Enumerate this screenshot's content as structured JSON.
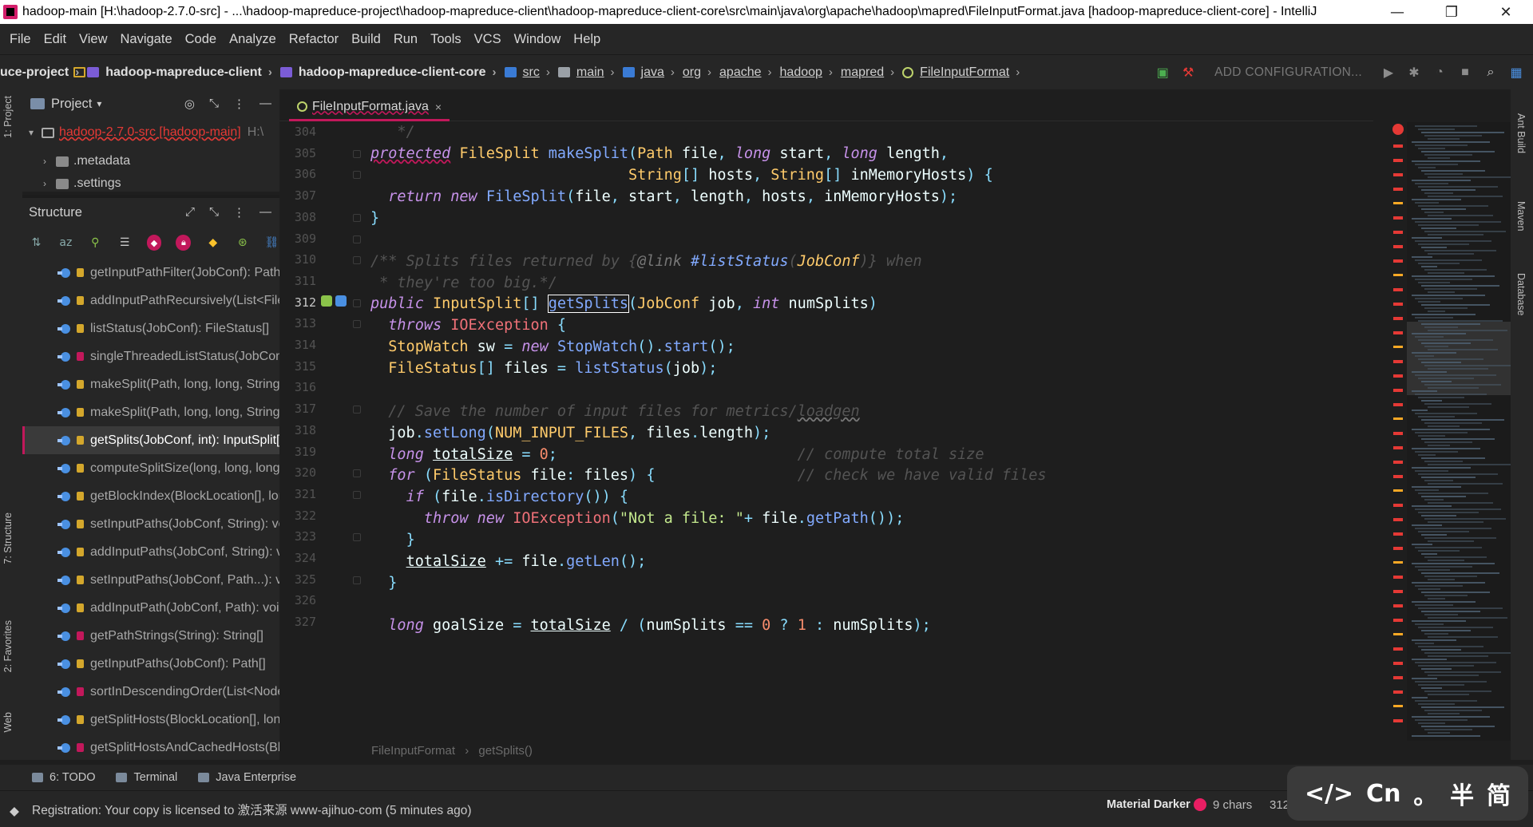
{
  "window": {
    "title": "hadoop-main [H:\\hadoop-2.7.0-src] - ...\\hadoop-mapreduce-project\\hadoop-mapreduce-client\\hadoop-mapreduce-client-core\\src\\main\\java\\org\\apache\\hadoop\\mapred\\FileInputFormat.java [hadoop-mapreduce-client-core] - IntelliJ",
    "minimize": "—",
    "maximize": "❐",
    "close": "✕"
  },
  "menu": [
    "File",
    "Edit",
    "View",
    "Navigate",
    "Code",
    "Analyze",
    "Refactor",
    "Build",
    "Run",
    "Tools",
    "VCS",
    "Window",
    "Help"
  ],
  "breadcrumbs": [
    {
      "label": "uce-project",
      "bold": true,
      "icon": "none"
    },
    {
      "label": "hadoop-mapreduce-client",
      "bold": true,
      "icon": "module"
    },
    {
      "label": "hadoop-mapreduce-client-core",
      "bold": true,
      "icon": "module"
    },
    {
      "label": "src",
      "bold": false,
      "icon": "folder-blue"
    },
    {
      "label": "main",
      "bold": false,
      "icon": "folder-gray"
    },
    {
      "label": "java",
      "bold": false,
      "icon": "folder-blue"
    },
    {
      "label": "org",
      "bold": false,
      "icon": "package"
    },
    {
      "label": "apache",
      "bold": false,
      "icon": "package"
    },
    {
      "label": "hadoop",
      "bold": false,
      "icon": "package"
    },
    {
      "label": "mapred",
      "bold": false,
      "icon": "package"
    },
    {
      "label": "FileInputFormat",
      "bold": false,
      "icon": "class"
    }
  ],
  "toolbar": {
    "add_configuration": "ADD CONFIGURATION...",
    "run_icon": "▶",
    "debug_icon": "✱",
    "profile_icon": "◔",
    "stop_icon": "■",
    "search_icon": "⌕"
  },
  "left_strip": {
    "project": "1: Project",
    "structure": "7: Structure",
    "favorites": "2: Favorites",
    "web": "Web"
  },
  "right_strip": {
    "ant": "Ant Build",
    "maven": "Maven",
    "database": "Database"
  },
  "project_panel": {
    "title": "Project",
    "dropdown": "▾",
    "root": "hadoop-2.7.0-src [hadoop-main]",
    "root_path": "H:\\",
    "rows": [
      ".metadata",
      ".settings"
    ]
  },
  "structure_panel": {
    "title": "Structure",
    "items": [
      {
        "label": "getInputPathFilter(JobConf): PathFilter",
        "lock": "public"
      },
      {
        "label": "addInputPathRecursively(List<FileStatus>, FileSystem, Path, PathFilter): void",
        "lock": "public"
      },
      {
        "label": "listStatus(JobConf): FileStatus[]",
        "lock": "public"
      },
      {
        "label": "singleThreadedListStatus(JobConf, Path[], PathFilter, boolean): List<FileStatus>",
        "lock": "private"
      },
      {
        "label": "makeSplit(Path, long, long, String[]): FileSplit",
        "lock": "public"
      },
      {
        "label": "makeSplit(Path, long, long, String[], String[]): FileSplit",
        "lock": "public"
      },
      {
        "label": "getSplits(JobConf, int): InputSplit[]",
        "lock": "public",
        "selected": true
      },
      {
        "label": "computeSplitSize(long, long, long): long",
        "lock": "public"
      },
      {
        "label": "getBlockIndex(BlockLocation[], long): int",
        "lock": "public"
      },
      {
        "label": "setInputPaths(JobConf, String): void",
        "lock": "public"
      },
      {
        "label": "addInputPaths(JobConf, String): void",
        "lock": "public"
      },
      {
        "label": "setInputPaths(JobConf, Path...): void",
        "lock": "public"
      },
      {
        "label": "addInputPath(JobConf, Path): void",
        "lock": "public"
      },
      {
        "label": "getPathStrings(String): String[]",
        "lock": "private"
      },
      {
        "label": "getInputPaths(JobConf): Path[]",
        "lock": "public"
      },
      {
        "label": "sortInDescendingOrder(List<NodeInfo>): void",
        "lock": "private"
      },
      {
        "label": "getSplitHosts(BlockLocation[], long, long, NetworkTopology): String[]",
        "lock": "public"
      },
      {
        "label": "getSplitHostsAndCachedHosts(BlockLocation[], long, long, NetworkTopology): String[][]",
        "lock": "private"
      }
    ]
  },
  "tab": {
    "label": "FileInputFormat.java",
    "close": "×"
  },
  "editor": {
    "line_numbers": [
      304,
      305,
      306,
      307,
      308,
      309,
      310,
      311,
      312,
      313,
      314,
      315,
      316,
      317,
      318,
      319,
      320,
      321,
      322,
      323,
      324,
      325,
      326,
      327
    ],
    "current_line": 312,
    "breadcrumb": [
      "FileInputFormat",
      "getSplits()"
    ]
  },
  "bottom_tools": [
    {
      "label": "6: TODO"
    },
    {
      "label": "Terminal"
    },
    {
      "label": "Java Enterprise"
    }
  ],
  "status": {
    "message": "Registration: Your copy is licensed to 激活来源 www-ajihuo-com (5 minutes ago)",
    "theme": "Material Darker",
    "chars": "9 chars",
    "position": "312"
  },
  "ime": [
    "</>",
    "Cn",
    "。",
    "半",
    "简"
  ]
}
